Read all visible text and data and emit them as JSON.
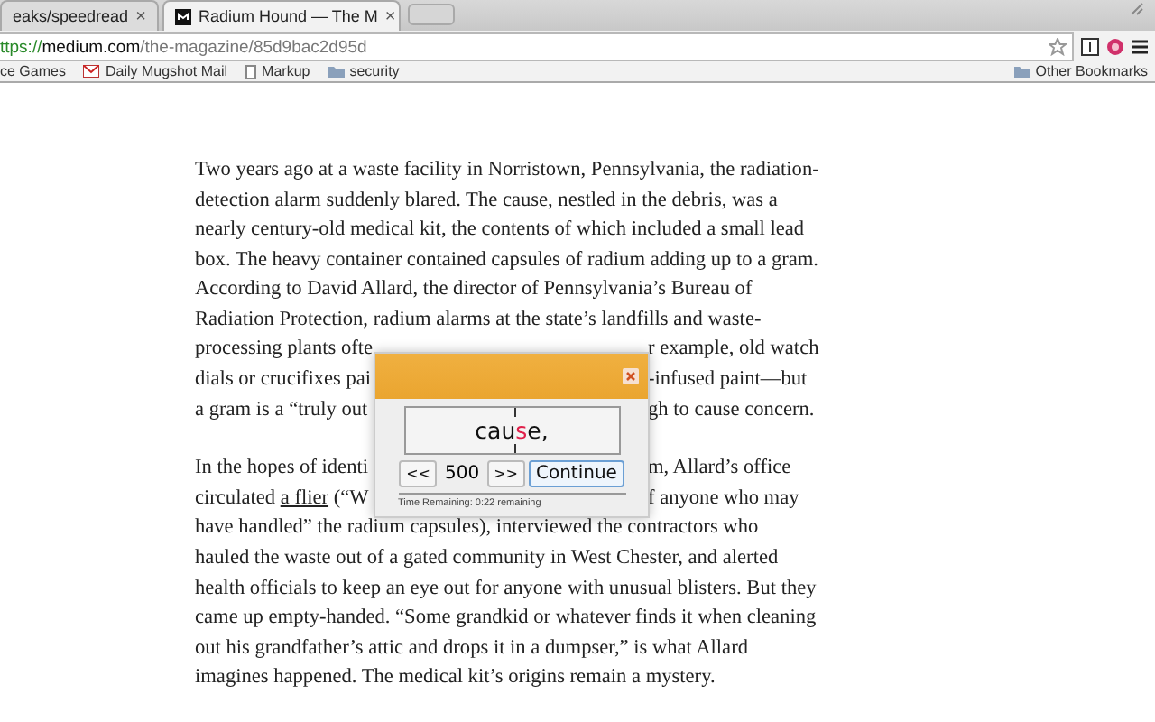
{
  "browser": {
    "tabs": [
      {
        "title": "eaks/speedread",
        "close": "×",
        "selected": false
      },
      {
        "title": "Radium Hound — The M",
        "close": "×",
        "selected": true
      }
    ],
    "address": {
      "scheme": "ttps://",
      "host": "medium.com",
      "path": "/the-magazine/85d9bac2d95d"
    },
    "bookmarks": [
      {
        "label": "ce Games",
        "kind": "plain"
      },
      {
        "label": "Daily Mugshot Mail",
        "kind": "mail"
      },
      {
        "label": "Markup",
        "kind": "page"
      },
      {
        "label": "security",
        "kind": "folder"
      }
    ],
    "other_bookmarks": "Other Bookmarks"
  },
  "article": {
    "paragraphs": [
      {
        "lines": [
          {
            "spans": [
              {
                "text": "Two years ago at a waste facility in Norristown, Pennsylvania, the radiation-",
                "link": false
              }
            ]
          },
          {
            "spans": [
              {
                "text": "detection alarm suddenly blared. The cause, nestled in the debris, was a",
                "link": false
              }
            ]
          },
          {
            "spans": [
              {
                "text": "nearly century-old medical kit, the contents of which included a small lead",
                "link": false
              }
            ]
          },
          {
            "spans": [
              {
                "text": "box. The heavy container contained capsules of radium adding up to a gram.",
                "link": false
              }
            ]
          },
          {
            "spans": [
              {
                "text": "According to David Allard, the director of Pennsylvania’s Bureau of",
                "link": false
              }
            ]
          },
          {
            "spans": [
              {
                "text": "Radiation Protection, radium alarms at the state’s landfills and waste-",
                "link": false
              }
            ]
          },
          {
            "spans": [
              {
                "text": "processing plants ofte",
                "link": false
              }
            ],
            "right": "r example, old watch"
          },
          {
            "spans": [
              {
                "text": "dials or crucifixes pai",
                "link": false
              }
            ],
            "right": "-infused paint—but"
          },
          {
            "spans": [
              {
                "text": "a gram is a “truly out",
                "link": false
              }
            ],
            "right": "gh to cause concern."
          }
        ]
      },
      {
        "lines": [
          {
            "spans": [
              {
                "text": "In the hopes of identi",
                "link": false
              }
            ],
            "right": "m, Allard’s office"
          },
          {
            "spans": [
              {
                "text": "circulated ",
                "link": false
              },
              {
                "text": "a flier",
                "link": true
              },
              {
                "text": " (“W",
                "link": false
              }
            ],
            "right": "f anyone who may"
          },
          {
            "spans": [
              {
                "text": "have handled” the radium capsules), interviewed the contractors who",
                "link": false
              }
            ]
          },
          {
            "spans": [
              {
                "text": "hauled the waste out of a gated community in West Chester, and alerted",
                "link": false
              }
            ]
          },
          {
            "spans": [
              {
                "text": "health officials to keep an eye out for anyone with unusual blisters. But they",
                "link": false
              }
            ]
          },
          {
            "spans": [
              {
                "text": "came up empty-handed. “Some grandkid or whatever finds it when cleaning",
                "link": false
              }
            ]
          },
          {
            "spans": [
              {
                "text": "out his grandfather’s attic and drops it in a dumpser,” is what Allard",
                "link": false
              }
            ]
          },
          {
            "spans": [
              {
                "text": "imagines happened. The medical kit’s origins remain a mystery.",
                "link": false
              }
            ]
          }
        ]
      }
    ]
  },
  "reader": {
    "word": {
      "before": "cau",
      "focus": "s",
      "after": "e,"
    },
    "back": "<<",
    "speed": "500",
    "forward": ">>",
    "continue": "Continue",
    "status": "Time Remaining: 0:22 remaining"
  }
}
